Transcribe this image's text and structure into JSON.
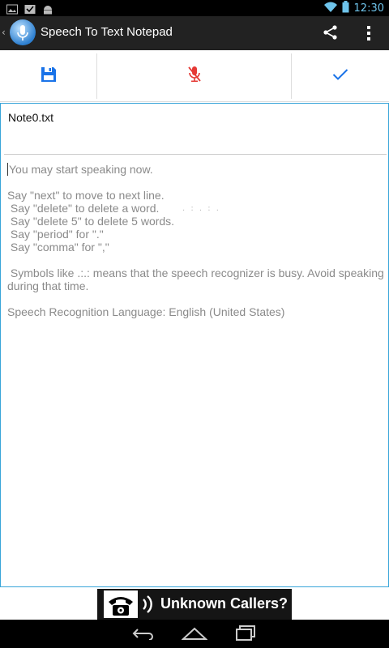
{
  "status_bar": {
    "time": "12:30",
    "icons": [
      "picture-icon",
      "checkmark-notification-icon",
      "android-icon",
      "wifi-icon",
      "battery-icon"
    ]
  },
  "action_bar": {
    "title": "Speech To Text Notepad",
    "actions": [
      "share-icon",
      "overflow-menu-icon"
    ]
  },
  "toolbar": {
    "buttons": [
      "save-icon",
      "microphone-muted-icon",
      "checkmark-icon"
    ]
  },
  "editor": {
    "filename": "Note0.txt",
    "lines": [
      "You may start speaking now.",
      "",
      "Say \"next\" to move to next line.",
      " Say \"delete\" to delete a word.",
      " Say \"delete 5\" to delete 5 words.",
      " Say \"period\" for \".\"",
      " Say \"comma\" for \",\"",
      "",
      " Symbols like .:.: means that the speech recognizer is busy. Avoid speaking during that time.",
      "",
      "Speech Recognition Language: English (United States)"
    ],
    "busy_indicator": ". : . : ."
  },
  "ad": {
    "text": "Unknown Callers?"
  },
  "nav_bar": {
    "buttons": [
      "back-icon",
      "home-icon",
      "recents-icon"
    ]
  },
  "colors": {
    "accent_blue": "#1a73e8",
    "mic_red": "#e53935",
    "frame_blue": "#38a5d9",
    "action_bar": "#222222"
  }
}
